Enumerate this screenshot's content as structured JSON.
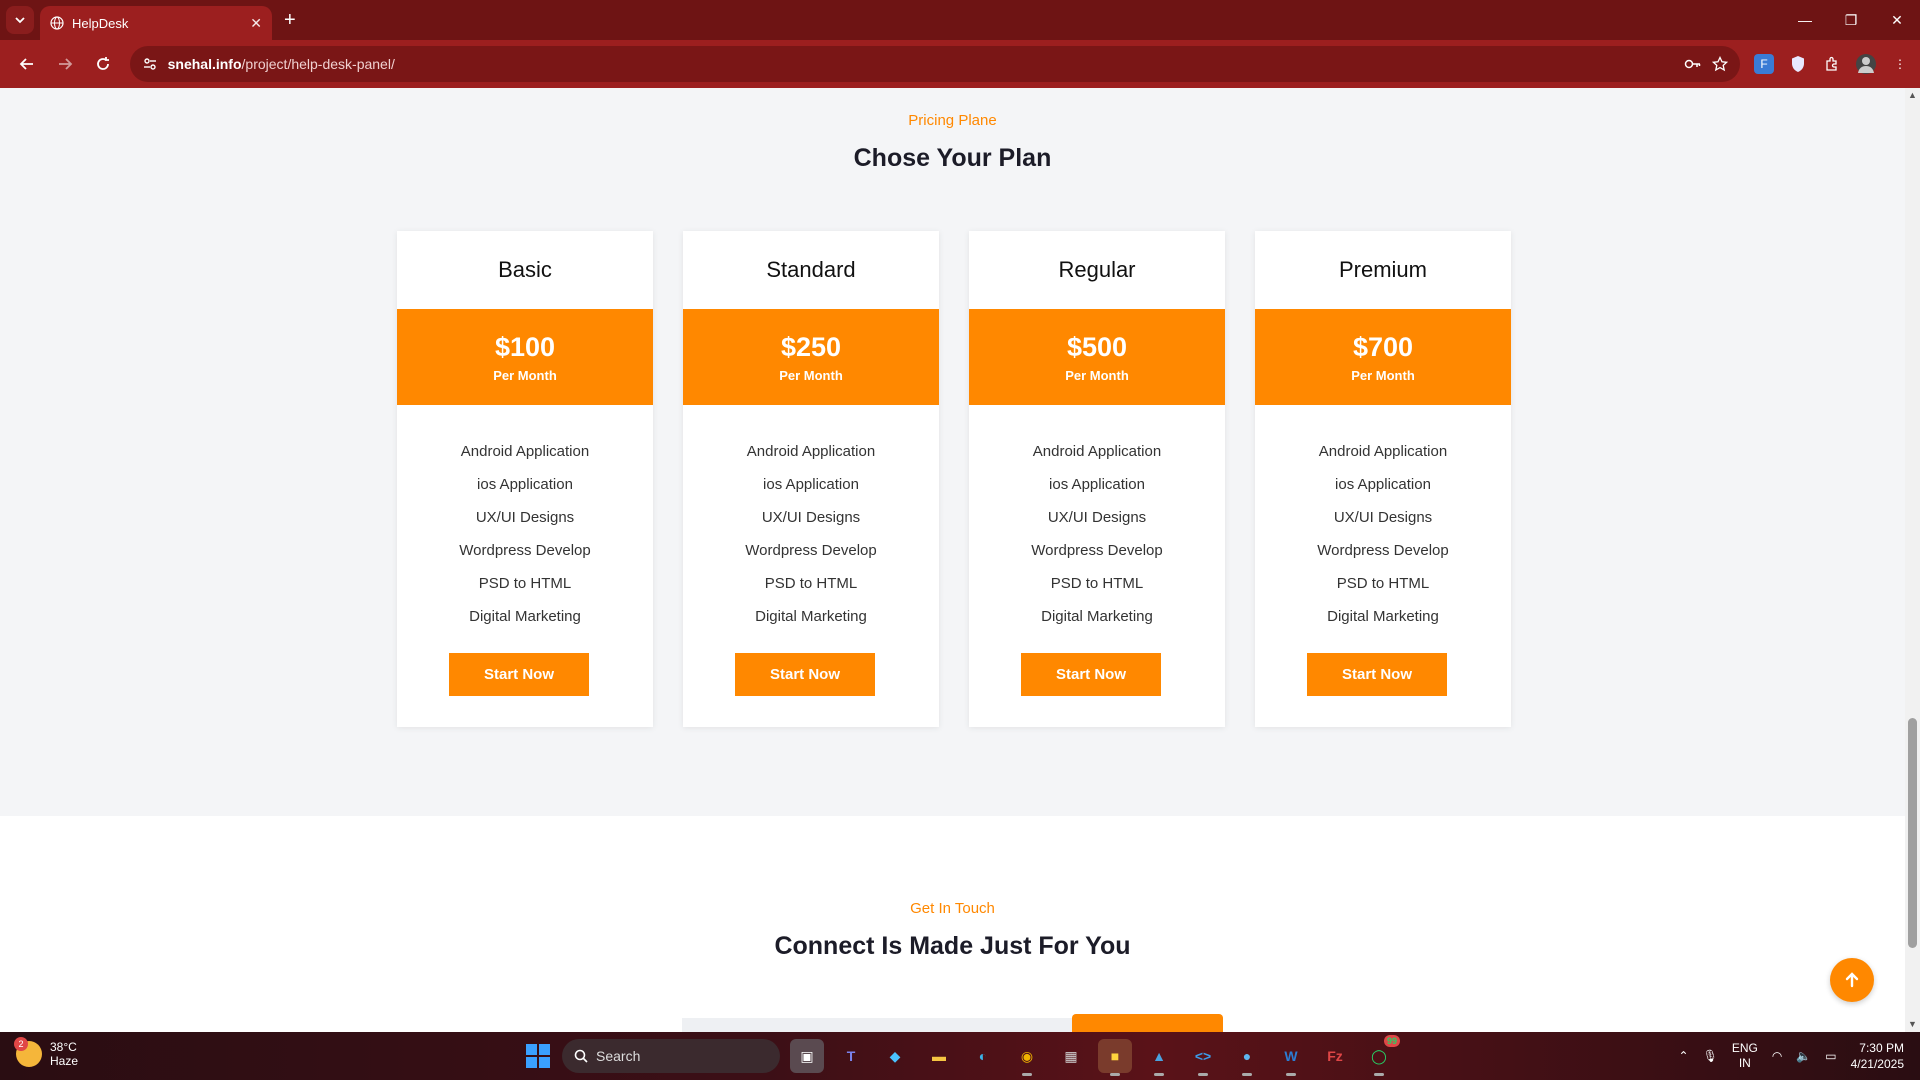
{
  "browser": {
    "tab_title": "HelpDesk",
    "url_host": "snehal.info",
    "url_path": "/project/help-desk-panel/"
  },
  "pricing": {
    "eyebrow": "Pricing Plane",
    "heading": "Chose Your Plan",
    "plans": [
      {
        "name": "Basic",
        "price": "$100",
        "period": "Per Month",
        "button": "Start Now"
      },
      {
        "name": "Standard",
        "price": "$250",
        "period": "Per Month",
        "button": "Start Now"
      },
      {
        "name": "Regular",
        "price": "$500",
        "period": "Per Month",
        "button": "Start Now"
      },
      {
        "name": "Premium",
        "price": "$700",
        "period": "Per Month",
        "button": "Start Now"
      }
    ],
    "features": [
      "Android Application",
      "ios Application",
      "UX/UI Designs",
      "Wordpress Develop",
      "PSD to HTML",
      "Digital Marketing"
    ]
  },
  "contact": {
    "eyebrow": "Get In Touch",
    "heading": "Connect Is Made Just For You"
  },
  "taskbar": {
    "temperature": "38°C",
    "weather": "Haze",
    "weather_badge": "2",
    "search_label": "Search",
    "whatsapp_badge": "99",
    "lang_line1": "ENG",
    "lang_line2": "IN",
    "time": "7:30 PM",
    "date": "4/21/2025"
  },
  "colors": {
    "accent": "#ff8800",
    "browser_frame": "#9c1f1f",
    "heading_text": "#1c1c28"
  }
}
